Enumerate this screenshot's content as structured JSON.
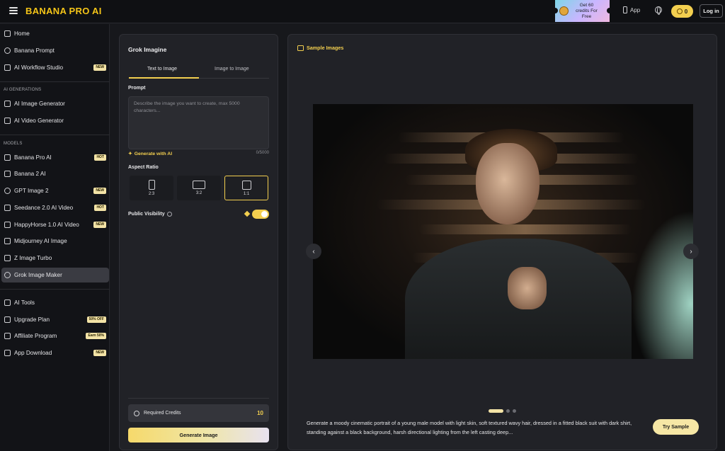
{
  "app": {
    "brand": "BANANA PRO AI"
  },
  "header": {
    "promo_text": "Get 60 credits For Free",
    "app_label": "App",
    "credits": "0",
    "login_label": "Log in"
  },
  "sidebar": {
    "top_items": [
      {
        "label": "Home",
        "icon": "home-icon"
      },
      {
        "label": "Banana Prompt",
        "icon": "bulb-icon"
      },
      {
        "label": "AI Workflow Studio",
        "icon": "workflow-icon",
        "badge": "NEW"
      }
    ],
    "section_generations": "AI GENERATIONS",
    "generation_items": [
      {
        "label": "AI Image Generator",
        "icon": "image-icon"
      },
      {
        "label": "AI Video Generator",
        "icon": "video-icon"
      }
    ],
    "section_models": "MODELS",
    "model_items": [
      {
        "label": "Banana Pro AI",
        "icon": "banana-icon",
        "badge": "HOT"
      },
      {
        "label": "Banana 2 AI",
        "icon": "banana-icon"
      },
      {
        "label": "GPT Image 2",
        "icon": "gpt-icon",
        "badge": "NEW"
      },
      {
        "label": "Seedance 2.0 AI Video",
        "icon": "seedance-icon",
        "badge": "HOT"
      },
      {
        "label": "HappyHorse 1.0 AI Video",
        "icon": "horse-icon",
        "badge": "NEW"
      },
      {
        "label": "Midjourney AI Image",
        "icon": "midjourney-icon"
      },
      {
        "label": "Z Image Turbo",
        "icon": "z-icon"
      },
      {
        "label": "Grok Image Maker",
        "icon": "grok-icon",
        "active": true
      }
    ],
    "bottom_items": [
      {
        "label": "AI Tools",
        "icon": "tools-icon"
      },
      {
        "label": "Upgrade Plan",
        "icon": "diamond-icon",
        "badge": "50% OFF"
      },
      {
        "label": "Affiliate Program",
        "icon": "affiliate-icon",
        "badge": "Earn 50%"
      },
      {
        "label": "App Download",
        "icon": "phone-icon",
        "badge": "NEW"
      }
    ]
  },
  "panel": {
    "title": "Grok Imagine",
    "tabs": [
      "Text to Image",
      "Image to Image"
    ],
    "prompt_label": "Prompt",
    "prompt_placeholder": "Describe the image you want to create, max 5000 characters...",
    "generate_with_ai": "Generate with AI",
    "char_counter": "0/5000",
    "aspect_label": "Aspect Ratio",
    "ratios": [
      "2:3",
      "3:2",
      "1:1"
    ],
    "selected_ratio": "1:1",
    "public_visibility": "Public Visibility",
    "public_visibility_on": true,
    "required_credits_label": "Required Credits",
    "required_credits": "10",
    "generate_button": "Generate Image"
  },
  "samples": {
    "title": "Sample Images",
    "caption": "Generate a moody cinematic portrait of a young male model with light skin, soft textured wavy hair, dressed in a fitted black suit with dark shirt, standing against a black background, harsh directional lighting from the left casting deep...",
    "try_button": "Try Sample",
    "carousel_index": 1,
    "carousel_count": 3
  },
  "colors": {
    "accent": "#f3cf4f",
    "background": "#17181c",
    "panel": "#212227"
  }
}
